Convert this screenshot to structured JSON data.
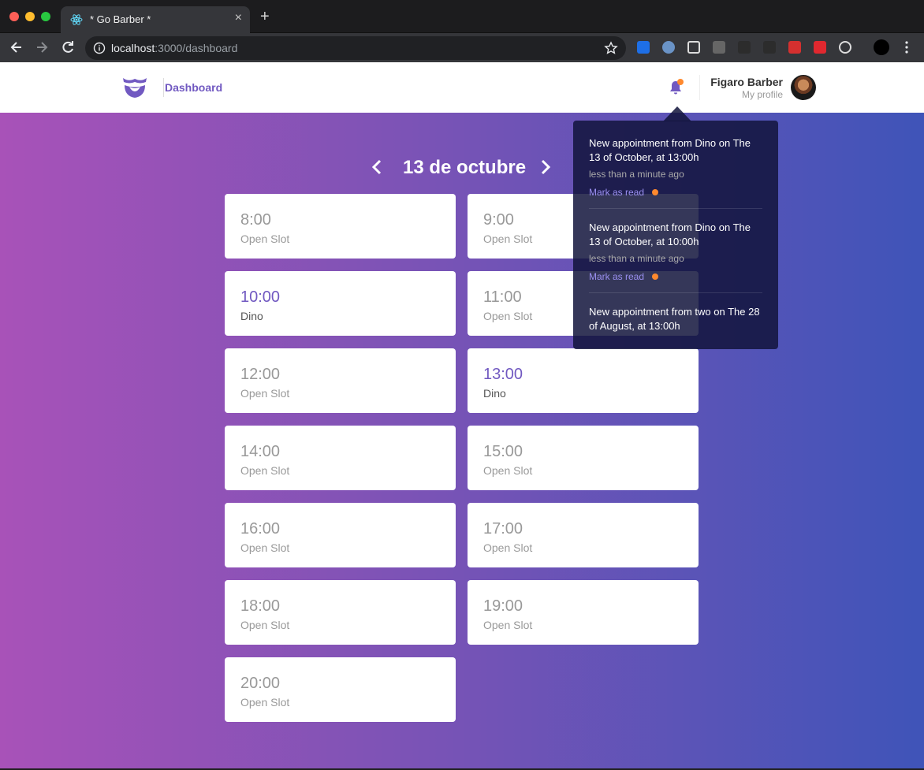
{
  "browser": {
    "tab_title": "* Go Barber *",
    "url_host": "localhost",
    "url_path": ":3000/dashboard"
  },
  "header": {
    "nav_link": "Dashboard",
    "profile_name": "Figaro Barber",
    "profile_link": "My profile",
    "has_unread": true
  },
  "schedule": {
    "date_label": "13 de octubre",
    "slots": [
      {
        "time": "8:00",
        "label": "Open Slot",
        "booked": false
      },
      {
        "time": "9:00",
        "label": "Open Slot",
        "booked": false
      },
      {
        "time": "10:00",
        "label": "Dino",
        "booked": true
      },
      {
        "time": "11:00",
        "label": "Open Slot",
        "booked": false
      },
      {
        "time": "12:00",
        "label": "Open Slot",
        "booked": false
      },
      {
        "time": "13:00",
        "label": "Dino",
        "booked": true
      },
      {
        "time": "14:00",
        "label": "Open Slot",
        "booked": false
      },
      {
        "time": "15:00",
        "label": "Open Slot",
        "booked": false
      },
      {
        "time": "16:00",
        "label": "Open Slot",
        "booked": false
      },
      {
        "time": "17:00",
        "label": "Open Slot",
        "booked": false
      },
      {
        "time": "18:00",
        "label": "Open Slot",
        "booked": false
      },
      {
        "time": "19:00",
        "label": "Open Slot",
        "booked": false
      },
      {
        "time": "20:00",
        "label": "Open Slot",
        "booked": false
      }
    ]
  },
  "notifications": [
    {
      "text": "New appointment from Dino on The 13 of October, at 13:00h",
      "time": "less than a minute ago",
      "action": "Mark as read"
    },
    {
      "text": "New appointment from Dino on The 13 of October, at 10:00h",
      "time": "less than a minute ago",
      "action": "Mark as read"
    },
    {
      "text": "New appointment from two on The 28 of August, at 13:00h",
      "time": "",
      "action": ""
    }
  ],
  "colors": {
    "accent": "#7159c1",
    "unread_dot": "#ff892e",
    "gradient_start": "#a852b8",
    "gradient_end": "#3f54b8"
  }
}
